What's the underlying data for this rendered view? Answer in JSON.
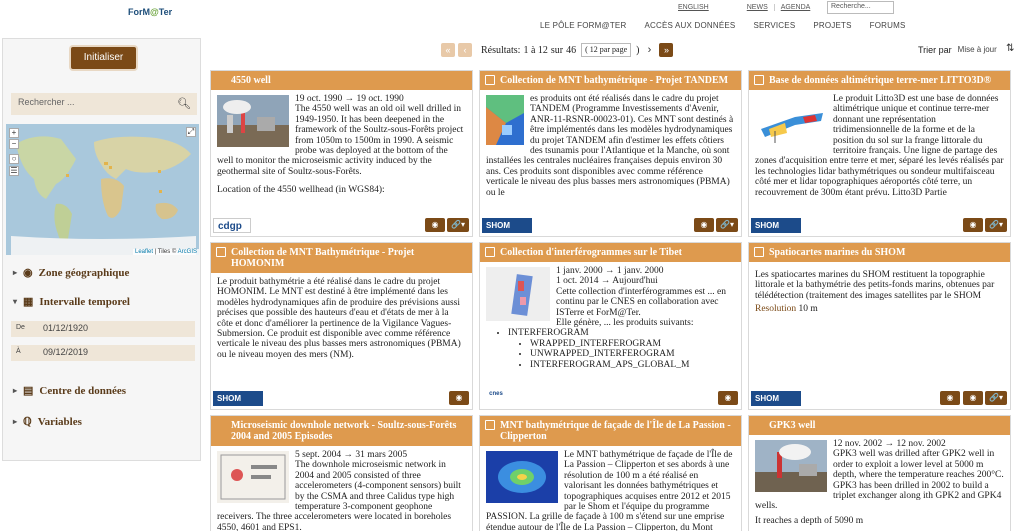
{
  "header": {
    "logo_main": "ForM",
    "logo_accent": "@",
    "logo_end": "Ter",
    "top_links": [
      "ENGLISH",
      "NEWS",
      "AGENDA"
    ],
    "search_placeholder": "Recherche...",
    "nav": [
      "LE PÔLE FORM@TER",
      "ACCÈS AUX DONNÉES",
      "SERVICES",
      "PROJETS",
      "FORUMS"
    ]
  },
  "sidebar": {
    "init_label": "Initialiser",
    "search_placeholder": "Rechercher ...",
    "map_zoom_in": "+",
    "map_zoom_out": "−",
    "map_attribution_leaflet": "Leaflet",
    "map_attribution_sep": " | Tiles © ",
    "map_attribution_arcgis": "ArcGIS",
    "filters": {
      "zone": "Zone géographique",
      "intervalle": "Intervalle temporel",
      "centre": "Centre de données",
      "variables": "Variables"
    },
    "date_from_label": "De",
    "date_from": "01/12/1920",
    "date_to_label": "À",
    "date_to": "09/12/2019"
  },
  "toolbar": {
    "results_prefix": "Résultats:",
    "results_range": "1 à 12",
    "results_sep": "sur",
    "results_total": "46",
    "per_page": "( 12 par page",
    "per_page_close": ")",
    "sort_label": "Trier par",
    "sort_value": "Mise à jour"
  },
  "cards": [
    {
      "title": "4550 well",
      "dates": "19 oct. 1990 → 19 oct. 1990",
      "text": "The 4550 well was an old oil well drilled in 1949-1950. It has been deepened in the framework of the Soultz-sous-Forêts project from 1050m to 1500m in 1990. A seismic probe was deployed at the bottom of the well to monitor the microseismic activity induced by the geothermal site of Soultz-sous-Forêts.",
      "text2": "Location of the 4550 wellhead (in WGS84):",
      "logo": "cdgp"
    },
    {
      "title": "Collection de MNT bathymétrique - Projet TANDEM",
      "text": "es produits ont été réalisés dans le cadre du projet TANDEM (Programme Investissements d'Avenir, ANR-11-RSNR-00023-01). Ces MNT sont destinés à être implémentés dans les modèles hydrodynamiques du projet TANDEM afin d'estimer les effets côtiers des tsunamis pour l'Atlantique et la Manche, où sont installées les centrales nucléaires françaises depuis environ 30 ans. Ces produits sont disponibles avec comme référence verticale le niveau des plus basses mers astronomiques (PBMA) ou le",
      "logo": "SHOM"
    },
    {
      "title": "Base de données altimétrique terre-mer LITTO3D®",
      "text": "Le produit Litto3D est une base de données altimétrique unique et continue terre-mer donnant une représentation tridimensionnelle de la forme et de la position du sol sur la frange littorale du territoire français. Une ligne de partage des zones d'acquisition entre terre et mer, séparé les levés réalisés par les technologies lidar bathymétriques ou sondeur multifaisceau côté mer et lidar topographiques aéroportés côté terre, un recouvrement de 300m étant prévu. Litto3D Partie",
      "logo": "SHOM"
    },
    {
      "title": "Collection de MNT Bathymétrique - Projet HOMONIM",
      "text": "Le produit bathymétrie a été réalisé dans le cadre du projet HOMONIM. Le MNT est destiné à être implémenté dans les modèles hydrodynamiques afin de produire des prévisions aussi précises que possible des hauteurs d'eau et d'états de mer à la côte et donc d'améliorer la pertinence de la Vigilance Vagues-Submersion. Ce produit est disponible avec comme référence verticale le niveau des plus basses mers astronomiques (PBMA) ou le niveau moyen des mers (NM).",
      "logo": "SHOM"
    },
    {
      "title": "Collection d'interférogrammes sur le Tibet",
      "dates": "1 janv. 2000 → 1 janv. 2000",
      "dates2": "1 oct. 2014 → Aujourd'hui",
      "text": "Cette collection d'interférogrammes est ... en continu par le CNES en collaboration avec ISTerre et ForM@Ter.",
      "text2": "Elle génère, ... les produits suivants:",
      "list_top": "INTERFEROGRAM",
      "list_items": [
        "WRAPPED_INTERFEROGRAM",
        "UNWRAPPED_INTERFEROGRAM",
        "INTERFEROGRAM_APS_GLOBAL_M"
      ],
      "logo": "cnes"
    },
    {
      "title": "Spatiocartes marines du SHOM",
      "text": "Les spatiocartes marines du SHOM restituent la topographie littorale et la bathymétrie des petits-fonds marins, obtenues par télédétection (traitement des images satellites par le SHOM",
      "res_label": "Resolution",
      "res_value": "10 m",
      "logo": "SHOM"
    },
    {
      "title": "Microseismic downhole network - Soultz-sous-Forêts 2004 and 2005 Episodes",
      "dates": "5 sept. 2004 → 31 mars 2005",
      "text": "The downhole microseismic network in 2004 and 2005 consisted of three accelerometers (4-component sensors) built by the CSMA and three Calidus type high temperature 3-component geophone receivers. The three accelerometers were located in boreholes 4550, 4601 and EPS1."
    },
    {
      "title": "MNT bathymétrique de façade de l'Île de La Passion - Clipperton",
      "text": "Le MNT bathymétrique de façade de l'Île de La Passion – Clipperton et ses abords à une résolution de 100 m a été réalisé en valorisant les données bathymétriques et topographiques acquises entre 2012 et 2015 par le Shom et l'équipe du programme PASSION. La grille de façade à 100 m s'étend sur une emprise étendue autour de l'Île de La Passion – Clipperton, du Mont"
    },
    {
      "title": "GPK3 well",
      "dates": "12 nov. 2002 → 12 nov. 2002",
      "text": "GPK3 well was drilled after GPK2 well in order to exploit a lower level at 5000 m depth, where the temperature reaches 200°C. GPK3 has been drilled in 2002 to build a triplet exchanger along ith GPK2 and GPK4 wells.",
      "text2": "It reaches a depth of 5090 m"
    }
  ]
}
